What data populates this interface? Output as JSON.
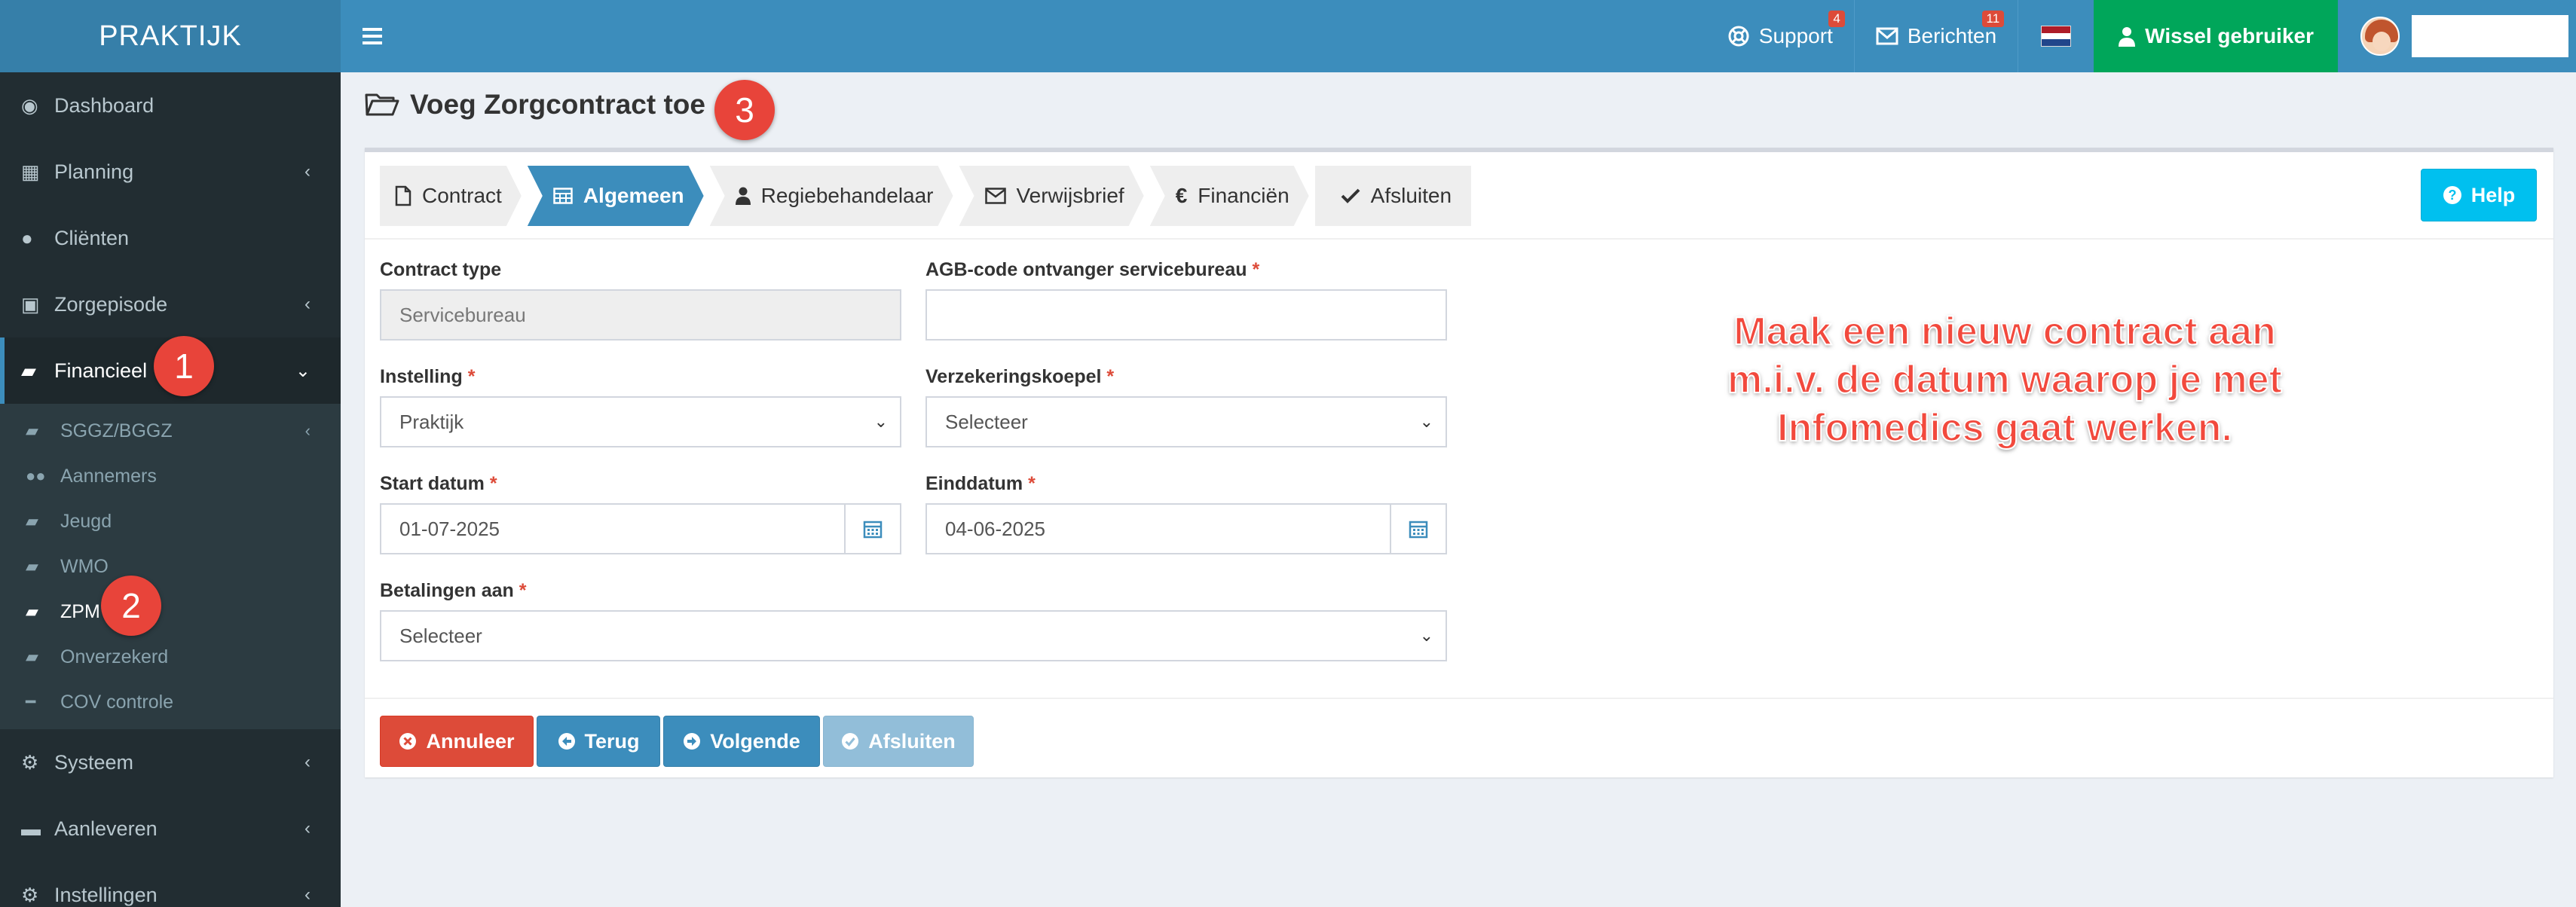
{
  "app": {
    "logo": "PRAKTIJK"
  },
  "topbar": {
    "support_label": "Support",
    "support_badge": "4",
    "berichten_label": "Berichten",
    "berichten_badge": "11",
    "wissel_label": "Wissel gebruiker"
  },
  "sidebar": {
    "items": [
      {
        "label": "Dashboard"
      },
      {
        "label": "Planning"
      },
      {
        "label": "Cliënten"
      },
      {
        "label": "Zorgepisode"
      },
      {
        "label": "Financieel"
      },
      {
        "label": "Systeem"
      },
      {
        "label": "Aanleveren"
      },
      {
        "label": "Instellingen"
      }
    ],
    "submenu": [
      {
        "label": "SGGZ/BGGZ"
      },
      {
        "label": "Aannemers"
      },
      {
        "label": "Jeugd"
      },
      {
        "label": "WMO"
      },
      {
        "label": "ZPM"
      },
      {
        "label": "Onverzekerd"
      },
      {
        "label": "COV controle"
      }
    ]
  },
  "steps": {
    "one": "1",
    "two": "2",
    "three": "3"
  },
  "page": {
    "title": "Voeg Zorgcontract toe"
  },
  "wizard": {
    "steps": [
      {
        "label": "Contract"
      },
      {
        "label": "Algemeen"
      },
      {
        "label": "Regiebehandelaar"
      },
      {
        "label": "Verwijsbrief"
      },
      {
        "label": "Financiën"
      },
      {
        "label": "Afsluiten"
      }
    ],
    "active": "Algemeen"
  },
  "help_label": "Help",
  "form": {
    "contract_type": {
      "label": "Contract type",
      "value": "Servicebureau"
    },
    "agb_code": {
      "label": "AGB-code ontvanger servicebureau",
      "value": ""
    },
    "instelling": {
      "label": "Instelling",
      "value": "Praktijk"
    },
    "verzekeringskoepel": {
      "label": "Verzekeringskoepel",
      "value": "Selecteer"
    },
    "start_datum": {
      "label": "Start datum",
      "value": "01-07-2025"
    },
    "einddatum": {
      "label": "Einddatum",
      "value": "04-06-2025"
    },
    "betalingen_aan": {
      "label": "Betalingen aan",
      "value": "Selecteer"
    },
    "required_mark": "*"
  },
  "buttons": {
    "annuleer": "Annuleer",
    "terug": "Terug",
    "volgende": "Volgende",
    "afsluiten": "Afsluiten"
  },
  "annotation": {
    "line1": "Maak een nieuw contract aan",
    "line2": "m.i.v. de datum waarop je met",
    "line3": "Infomedics gaat werken."
  },
  "colors": {
    "header": "#3c8dbc",
    "logo_bg": "#367fa9",
    "sidebar": "#222d32",
    "success": "#00a65a",
    "danger": "#dd4b39",
    "info": "#00c0ef",
    "annotation": "#f2493d"
  }
}
